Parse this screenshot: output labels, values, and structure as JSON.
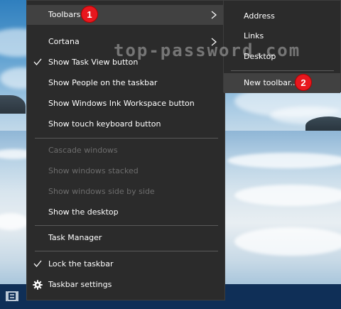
{
  "watermark": "top-password.com",
  "context_menu": {
    "items": [
      {
        "label": "Toolbars",
        "checked": false,
        "disabled": false,
        "submenu": true,
        "hover": true
      },
      {
        "label": "Cortana",
        "checked": false,
        "disabled": false,
        "submenu": true
      },
      {
        "label": "Show Task View button",
        "checked": true,
        "disabled": false
      },
      {
        "label": "Show People on the taskbar",
        "checked": false,
        "disabled": false
      },
      {
        "label": "Show Windows Ink Workspace button",
        "checked": false,
        "disabled": false
      },
      {
        "label": "Show touch keyboard button",
        "checked": false,
        "disabled": false
      },
      {
        "label": "Cascade windows",
        "checked": false,
        "disabled": true
      },
      {
        "label": "Show windows stacked",
        "checked": false,
        "disabled": true
      },
      {
        "label": "Show windows side by side",
        "checked": false,
        "disabled": true
      },
      {
        "label": "Show the desktop",
        "checked": false,
        "disabled": false
      },
      {
        "label": "Task Manager",
        "checked": false,
        "disabled": false
      },
      {
        "label": "Lock the taskbar",
        "checked": true,
        "disabled": false
      },
      {
        "label": "Taskbar settings",
        "icon": "gear-icon",
        "disabled": false
      }
    ]
  },
  "toolbars_submenu": {
    "items": [
      {
        "label": "Address"
      },
      {
        "label": "Links"
      },
      {
        "label": "Desktop"
      },
      {
        "label": "New toolbar...",
        "hover": true
      }
    ]
  },
  "step_badges": [
    "1",
    "2"
  ],
  "colors": {
    "menu_bg": "#2b2b2b",
    "menu_hover": "#414141",
    "disabled_text": "#6d6d6d",
    "badge_red": "#e8171e",
    "taskbar": "#0f2f57"
  },
  "icons": {
    "taskbar": "task-view-icon",
    "check": "check-icon",
    "arrow": "chevron-right-icon",
    "settings": "gear-icon"
  }
}
